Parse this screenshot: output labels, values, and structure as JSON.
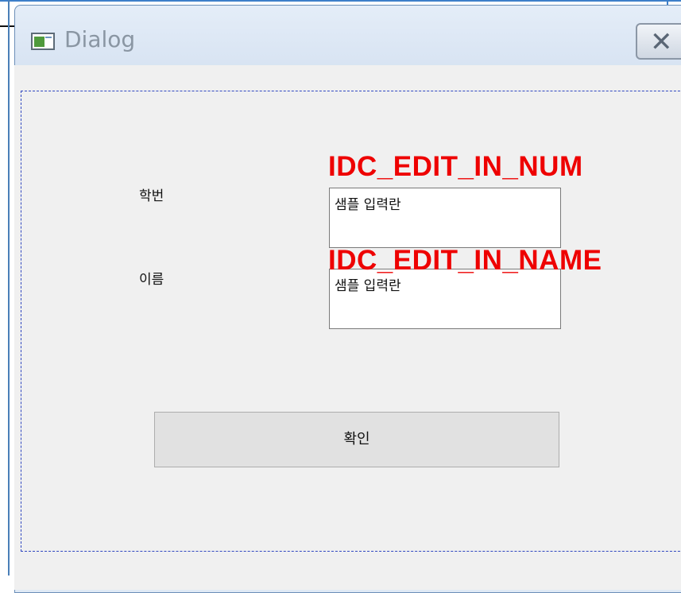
{
  "window": {
    "title": "Dialog",
    "close_glyph": "✕",
    "icon": "app-window-icon"
  },
  "form": {
    "student_id_label": "학번",
    "name_label": "이름",
    "student_id_value": "샘플 입력란",
    "name_value": "샘플 입력란",
    "confirm_label": "확인"
  },
  "annotations": {
    "edit_in_num": "IDC_EDIT_IN_NUM",
    "edit_in_name": "IDC_EDIT_IN_NAME"
  },
  "colors": {
    "annotation": "#ee0000",
    "dialog_background": "#f0f0f0",
    "frame_border": "#2f47c0"
  }
}
